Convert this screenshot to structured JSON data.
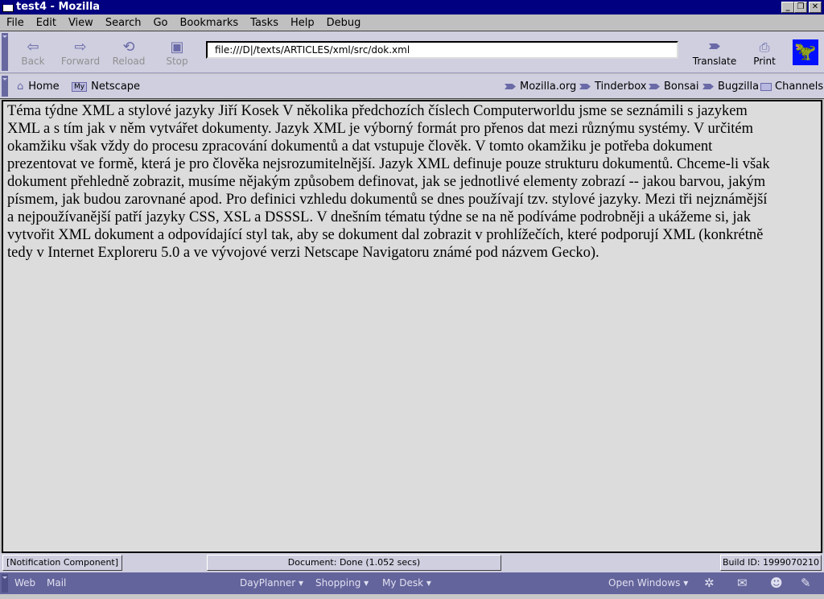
{
  "window": {
    "title": "test4 - Mozilla"
  },
  "menu": [
    "File",
    "Edit",
    "View",
    "Search",
    "Go",
    "Bookmarks",
    "Tasks",
    "Help",
    "Debug"
  ],
  "toolbar": {
    "back": "Back",
    "forward": "Forward",
    "reload": "Reload",
    "stop": "Stop",
    "url": "file:///D|/texts/ARTICLES/xml/src/dok.xml",
    "translate": "Translate",
    "print": "Print"
  },
  "personal": {
    "home": "Home",
    "netscape": "Netscape",
    "my_badge": "My",
    "links": [
      "Mozilla.org",
      "Tinderbox",
      "Bonsai",
      "Bugzilla"
    ],
    "channels": "Channels"
  },
  "content": {
    "lines": [
      "Téma týdne XML a stylové jazyky Jiří Kosek V několika předchozích číslech Computerworldu jsme se seznámili s jazykem",
      "XML a s tím jak v něm vytvářet dokumenty. Jazyk XML je výborný formát pro přenos dat mezi různýmu systémy. V určitém",
      "okamžiku však vždy do procesu zpracování dokumentů a dat vstupuje člověk. V tomto okamžiku je potřeba dokument",
      "prezentovat ve formě, která je pro člověka nejsrozumitelnější. Jazyk XML definuje pouze strukturu dokumentů. Chceme-li však",
      "dokument přehledně zobrazit, musíme nějakým způsobem definovat, jak se jednotlivé elementy zobrazí -- jakou barvou, jakým",
      "písmem, jak budou zarovnané apod. Pro definici vzhledu dokumentů se dnes používají tzv. stylové jazyky. Mezi tři nejznámější",
      "a nejpoužívanější patří jazyky CSS, XSL a DSSSL. V dnešním tématu týdne se na ně podíváme podrobněji a ukážeme si, jak",
      "vytvořit XML dokument a odpovídající styl tak, aby se dokument dal zobrazit v prohlížečích, které podporují XML (konkrétně",
      "tedy v Internet Exploreru 5.0 a ve vývojové verzi Netscape Navigatoru známé pod názvem Gecko)."
    ]
  },
  "status": {
    "notification": "[Notification Component]",
    "document": "Document: Done (1.052 secs)",
    "build": "Build ID: 1999070210"
  },
  "taskbar": {
    "web": "Web",
    "mail": "Mail",
    "dayplanner": "DayPlanner ▾",
    "shopping": "Shopping ▾",
    "mydesk": "My Desk ▾",
    "open_windows": "Open Windows ▾"
  }
}
